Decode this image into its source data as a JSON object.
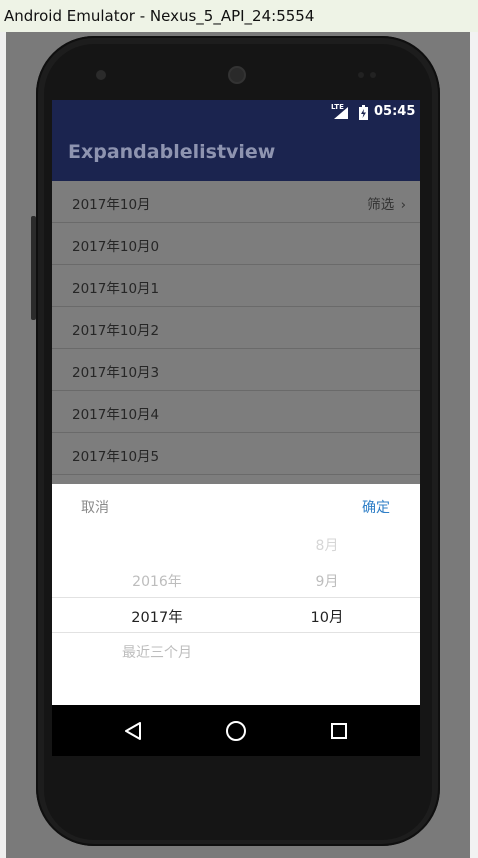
{
  "window": {
    "title": "Android Emulator - Nexus_5_API_24:5554"
  },
  "status_bar": {
    "network": "LTE",
    "time": "05:45"
  },
  "app_bar": {
    "title": "Expandablelistview"
  },
  "list": {
    "header_label": "2017年10月",
    "filter_label": "筛选",
    "items": [
      "2017年10月0",
      "2017年10月1",
      "2017年10月2",
      "2017年10月3",
      "2017年10月4",
      "2017年10月5"
    ]
  },
  "picker": {
    "cancel_label": "取消",
    "confirm_label": "确定",
    "year_options": [
      "2016年",
      "2017年",
      "最近三个月"
    ],
    "selected_year": "2017年",
    "month_options": [
      "8月",
      "9月",
      "10月"
    ],
    "selected_month": "10月"
  },
  "colors": {
    "app_bar": "#1b244f",
    "accent": "#2f7fc7",
    "scrim": "#7d7d7d"
  }
}
